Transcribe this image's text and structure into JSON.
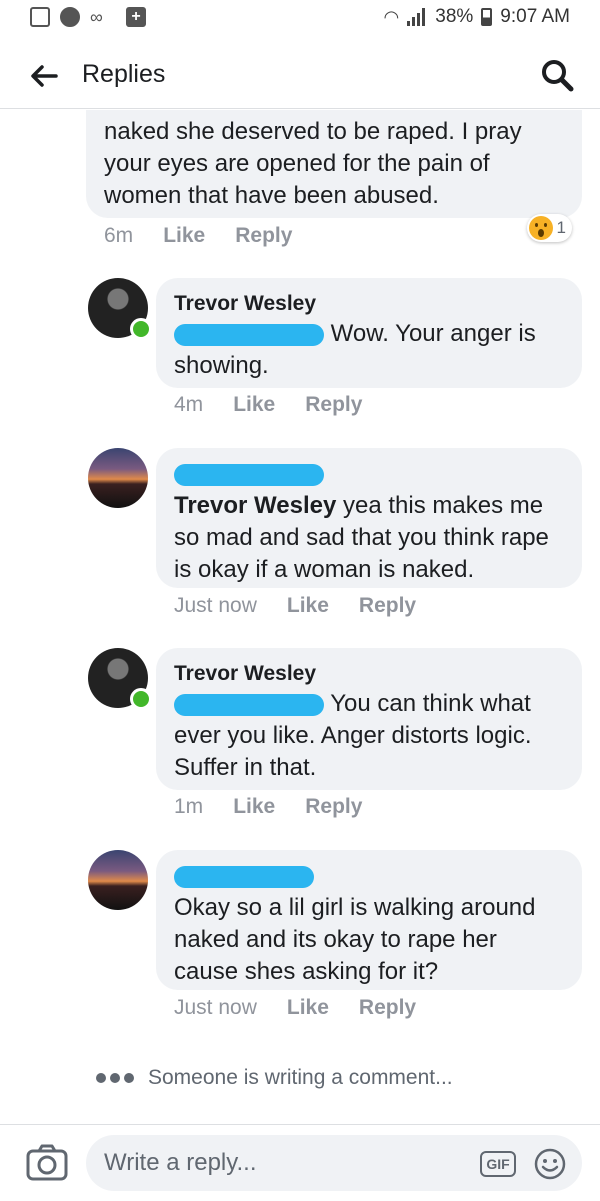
{
  "status_bar": {
    "battery": "38%",
    "time": "9:07 AM"
  },
  "header": {
    "title": "Replies"
  },
  "comments": [
    {
      "text": "naked she deserved to be raped. I pray your eyes are opened for the pain of women that have been abused.",
      "time": "6m",
      "like": "Like",
      "reply": "Reply",
      "reaction": {
        "icon": "wow-icon",
        "count": "1"
      }
    },
    {
      "author": "Trevor Wesley",
      "text": "Wow. Your anger is showing.",
      "time": "4m",
      "like": "Like",
      "reply": "Reply"
    },
    {
      "mention": "Trevor Wesley",
      "text": " yea this makes me so mad and sad that you think rape is okay if a woman is naked.",
      "time": "Just now",
      "like": "Like",
      "reply": "Reply"
    },
    {
      "author": "Trevor Wesley",
      "text": "You can think what ever you like. Anger distorts logic. Suffer in that.",
      "time": "1m",
      "like": "Like",
      "reply": "Reply"
    },
    {
      "text": "Okay so a lil girl is walking around naked and its okay to rape her cause shes asking for it?",
      "time": "Just now",
      "like": "Like",
      "reply": "Reply"
    }
  ],
  "typing_indicator": "Someone is writing a comment...",
  "composer": {
    "placeholder": "Write a reply...",
    "gif_label": "GIF"
  },
  "colors": {
    "bubble": "#f0f2f5",
    "online": "#42b72a",
    "redaction": "#2bb5f0",
    "wow": "#f7b125"
  }
}
